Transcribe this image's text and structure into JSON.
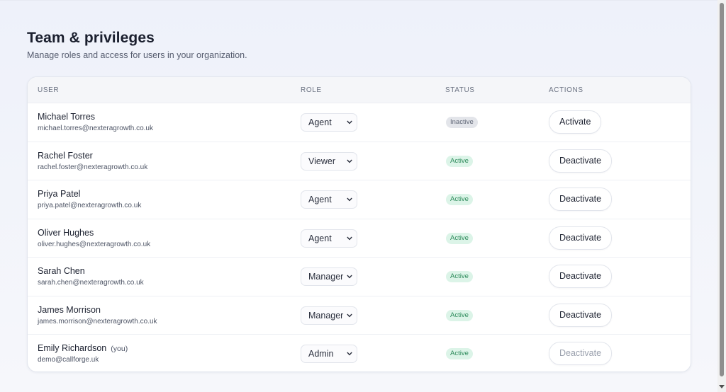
{
  "header": {
    "title": "Team & privileges",
    "subtitle": "Manage roles and access for users in your organization."
  },
  "table": {
    "columns": [
      "USER",
      "ROLE",
      "STATUS",
      "ACTIONS"
    ],
    "rows": [
      {
        "name": "Michael Torres",
        "you": "",
        "email": "michael.torres@nexteragrowth.co.uk",
        "role": "Agent",
        "status": "Inactive",
        "status_kind": "inactive",
        "action": "Activate",
        "action_enabled": true
      },
      {
        "name": "Rachel Foster",
        "you": "",
        "email": "rachel.foster@nexteragrowth.co.uk",
        "role": "Viewer",
        "status": "Active",
        "status_kind": "active",
        "action": "Deactivate",
        "action_enabled": true
      },
      {
        "name": "Priya Patel",
        "you": "",
        "email": "priya.patel@nexteragrowth.co.uk",
        "role": "Agent",
        "status": "Active",
        "status_kind": "active",
        "action": "Deactivate",
        "action_enabled": true
      },
      {
        "name": "Oliver Hughes",
        "you": "",
        "email": "oliver.hughes@nexteragrowth.co.uk",
        "role": "Agent",
        "status": "Active",
        "status_kind": "active",
        "action": "Deactivate",
        "action_enabled": true
      },
      {
        "name": "Sarah Chen",
        "you": "",
        "email": "sarah.chen@nexteragrowth.co.uk",
        "role": "Manager",
        "status": "Active",
        "status_kind": "active",
        "action": "Deactivate",
        "action_enabled": true
      },
      {
        "name": "James Morrison",
        "you": "",
        "email": "james.morrison@nexteragrowth.co.uk",
        "role": "Manager",
        "status": "Active",
        "status_kind": "active",
        "action": "Deactivate",
        "action_enabled": true
      },
      {
        "name": "Emily Richardson",
        "you": "(you)",
        "email": "demo@callforge.uk",
        "role": "Admin",
        "status": "Active",
        "status_kind": "active",
        "action": "Deactivate",
        "action_enabled": false
      }
    ]
  },
  "icons": {
    "role_dropdown": "chevron-down-icon",
    "scroll_down": "scroll-down-arrow-icon"
  },
  "colors": {
    "active_badge_bg": "#dcf4e8",
    "active_badge_text": "#2c8a5a",
    "inactive_badge_bg": "#e3e5ea",
    "inactive_badge_text": "#5f6676"
  }
}
